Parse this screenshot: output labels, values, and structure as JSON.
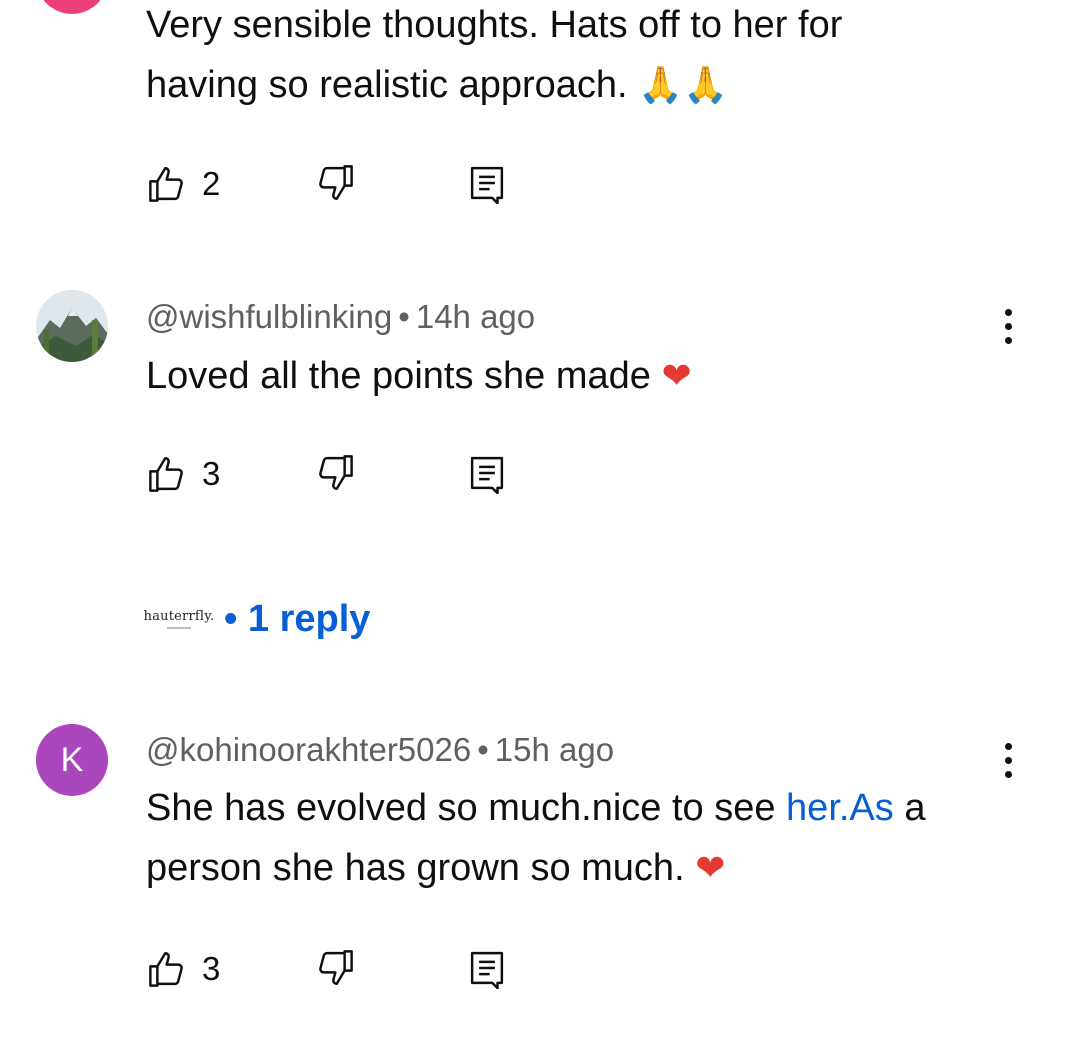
{
  "comments": [
    {
      "text_lines": [
        "Very sensible thoughts.  Hats off to her for",
        "having so realistic approach. "
      ],
      "emoji": "🙏🙏",
      "likes": "2"
    },
    {
      "handle": "@wishfulblinking",
      "time": "14h ago",
      "text": "Loved all the points she made ",
      "emoji": "❤",
      "likes": "3",
      "replies": "1 reply",
      "creator_logo": "hauterrfly."
    },
    {
      "handle": "@kohinoorakhter5026",
      "time": "15h ago",
      "avatar_letter": "K",
      "avatar_color": "#ab47bc",
      "text_line1_a": "She has evolved  so much.nice to see ",
      "text_line1_link": "her.As",
      "text_line1_b": " a",
      "text_line2": "person  she has  grown  so  much. ",
      "emoji": "❤",
      "likes": "3"
    }
  ],
  "separator": "•",
  "colors": {
    "link": "#065fd4",
    "meta": "#606060",
    "text": "#0f0f0f",
    "avatar_partial": "#ec407a"
  },
  "icons": {
    "like": "thumb-up-icon",
    "dislike": "thumb-down-icon",
    "reply": "comment-reply-icon",
    "menu": "more-vert-icon"
  }
}
